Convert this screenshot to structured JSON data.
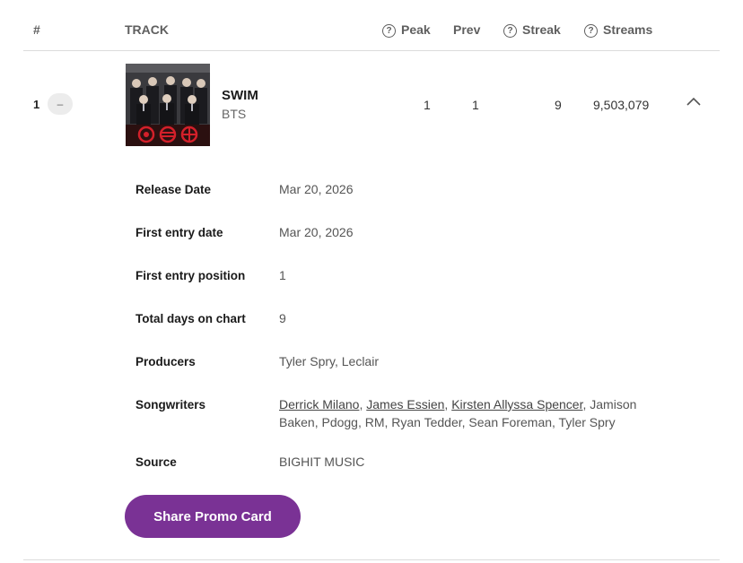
{
  "header": {
    "rank": "#",
    "track": "TRACK",
    "peak": "Peak",
    "prev": "Prev",
    "streak": "Streak",
    "streams": "Streams",
    "help_icon_glyph": "?"
  },
  "row": {
    "rank": "1",
    "trend": "–",
    "title": "SWIM",
    "artist": "BTS",
    "peak": "1",
    "prev": "1",
    "streak": "9",
    "streams": "9,503,079",
    "expanded_icon": "chevron-up-icon"
  },
  "details": {
    "release_date": {
      "label": "Release Date",
      "value": "Mar 20, 2026"
    },
    "first_entry_date": {
      "label": "First entry date",
      "value": "Mar 20, 2026"
    },
    "first_entry_position": {
      "label": "First entry position",
      "value": "1"
    },
    "total_days": {
      "label": "Total days on chart",
      "value": "9"
    },
    "producers": {
      "label": "Producers",
      "value": "Tyler Spry, Leclair"
    },
    "songwriters": {
      "label": "Songwriters",
      "linked": [
        "Derrick Milano",
        "James Essien",
        "Kirsten Allyssa Spencer"
      ],
      "rest": ", Jamison Baken, Pdogg, RM, Ryan Tedder, Sean Foreman, Tyler Spry"
    },
    "source": {
      "label": "Source",
      "value": "BIGHIT MUSIC"
    }
  },
  "share_button": "Share Promo Card",
  "colors": {
    "accent": "#7a3295",
    "rule": "#dcdcdc"
  }
}
